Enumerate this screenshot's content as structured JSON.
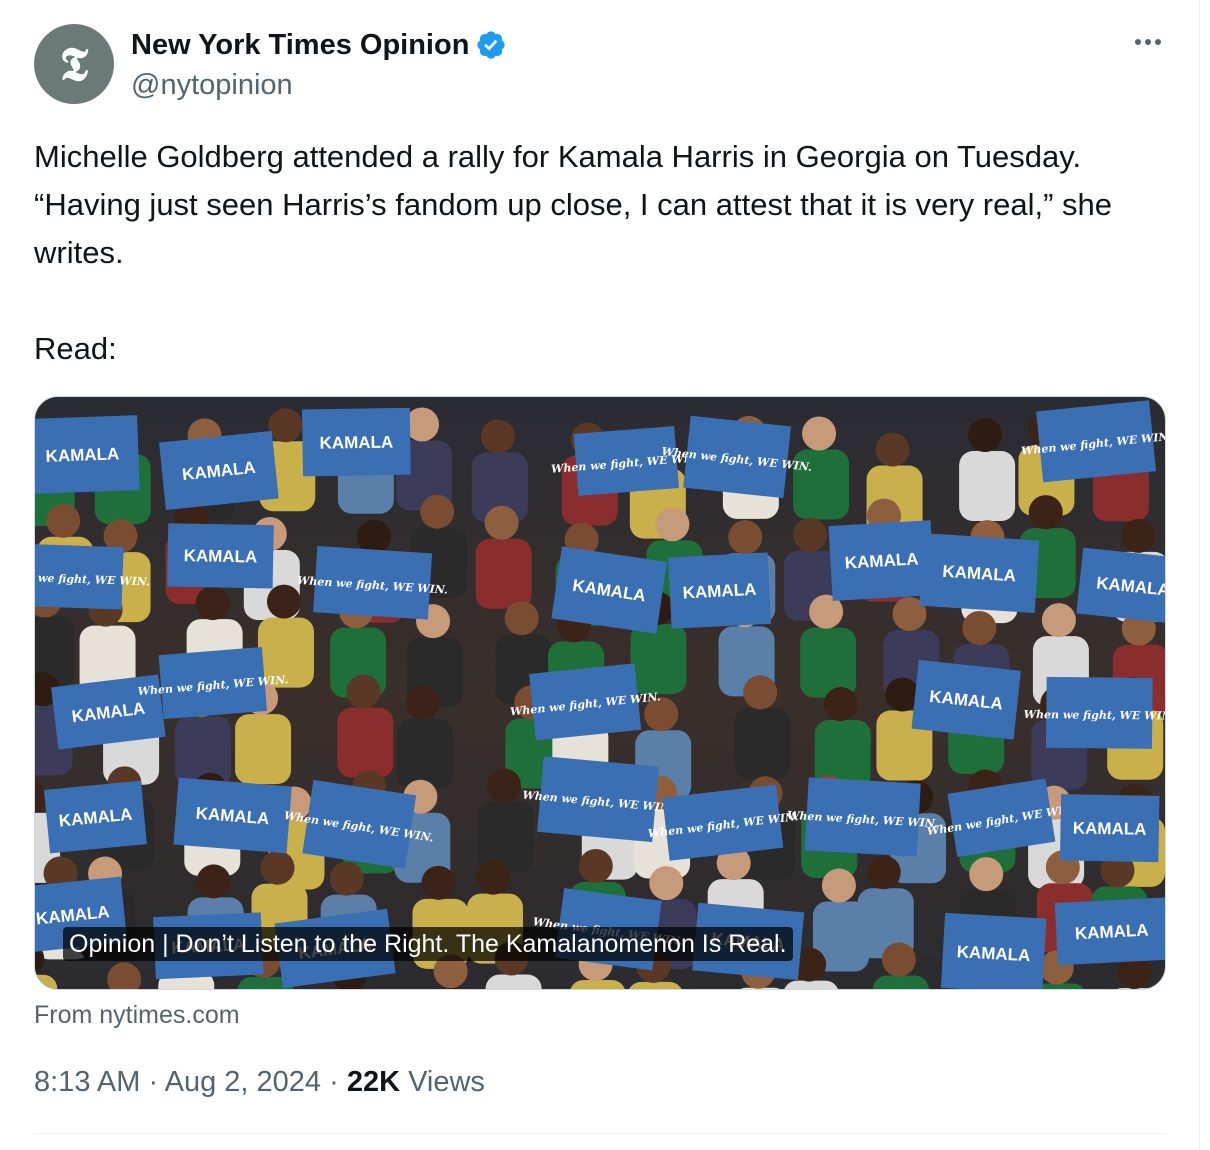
{
  "author": {
    "name": "New York Times Opinion",
    "handle": "@nytopinion",
    "avatar_glyph": "𝕿",
    "verified": true,
    "verified_color": "#1d9bf0"
  },
  "tweet": {
    "text": "Michelle Goldberg attended a rally for Kamala Harris in Georgia on Tuesday. “Having just seen Harris’s fandom up close, I can attest that it is very real,” she writes.\n\nRead:",
    "link_card": {
      "title": "Opinion | Don’t Listen to the Right. The Kamalanomenon Is Real.",
      "source": "From nytimes.com",
      "sign_texts": [
        "KAMALA",
        "When we fight, WE WIN."
      ]
    },
    "time": "8:13 AM",
    "date": "Aug 2, 2024",
    "separator": "·",
    "views_count": "22K",
    "views_label": "Views"
  },
  "colors": {
    "text": "#0f1419",
    "secondary": "#536471",
    "sign_blue": "#3a6fb4"
  },
  "icons": {
    "more": "more-dots-icon",
    "verified": "verified-badge-icon"
  }
}
